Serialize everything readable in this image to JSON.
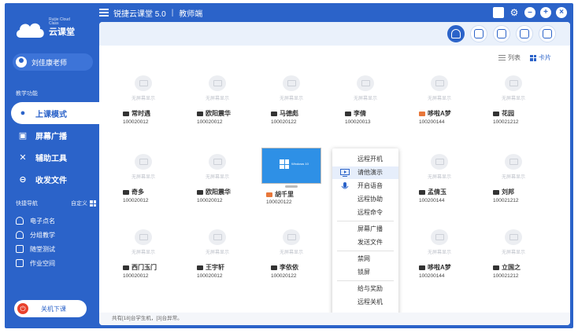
{
  "app": {
    "title": "锐捷云课堂 5.0",
    "mode": "教师端",
    "brand": "云课堂",
    "brand_small": "Ruijie Cloud Class"
  },
  "sidebar": {
    "user": "刘佳康老师",
    "section_title": "教学功能",
    "main_menu": [
      {
        "label": "上课模式",
        "icon": "bulb-icon",
        "active": true
      },
      {
        "label": "屏幕广播",
        "icon": "screen-broadcast-icon",
        "active": false
      },
      {
        "label": "辅助工具",
        "icon": "tools-icon",
        "active": false
      },
      {
        "label": "收发文件",
        "icon": "file-exchange-icon",
        "active": false
      }
    ],
    "quick_nav_title": "快捷导航",
    "quick_nav_custom": "自定义",
    "quick_nav": [
      {
        "label": "电子点名",
        "icon": "roll-call-icon"
      },
      {
        "label": "分组教学",
        "icon": "group-icon"
      },
      {
        "label": "随堂测试",
        "icon": "quiz-icon"
      },
      {
        "label": "作业空间",
        "icon": "homework-icon"
      }
    ],
    "shutdown_label": "关机下课"
  },
  "toolbar": {
    "tools": [
      "wifi-icon",
      "screenshot-icon",
      "cloud-icon",
      "hand-icon",
      "mic-icon"
    ]
  },
  "view": {
    "list_label": "列表",
    "card_label": "卡片"
  },
  "no_screen_text": "无屏幕显示",
  "students": [
    {
      "name": "常时遇",
      "id": "100020012",
      "orange": false
    },
    {
      "name": "欧阳震华",
      "id": "100020012",
      "orange": false
    },
    {
      "name": "马德彪",
      "id": "100020122",
      "orange": false
    },
    {
      "name": "李倩",
      "id": "100020013",
      "orange": false
    },
    {
      "name": "哆啦A梦",
      "id": "100200144",
      "orange": true
    },
    {
      "name": "花园",
      "id": "100021212",
      "orange": false
    },
    {
      "name": "奇多",
      "id": "100020012",
      "orange": false
    },
    {
      "name": "欧阳震华",
      "id": "100020012",
      "orange": false
    },
    {
      "name": "胡千里",
      "id": "100020122",
      "orange": true,
      "windows": true
    },
    {
      "name": "孟倩玉",
      "id": "100200144",
      "orange": false
    },
    {
      "name": "刘邦",
      "id": "100021212",
      "orange": false
    },
    {
      "name": "西门玉门",
      "id": "100020012",
      "orange": false
    },
    {
      "name": "王宇轩",
      "id": "100020012",
      "orange": false
    },
    {
      "name": "李依依",
      "id": "100020122",
      "orange": false
    },
    {
      "name": "哆啦A梦",
      "id": "100200144",
      "orange": false
    },
    {
      "name": "立国之",
      "id": "100021212",
      "orange": false
    }
  ],
  "windows_screen_text": "Windows 10",
  "context_menu": [
    {
      "label": "远程开机",
      "highlight": false,
      "icon": ""
    },
    {
      "label": "请他演示",
      "highlight": true,
      "icon": "present-icon"
    },
    {
      "label": "开启语音",
      "highlight": false,
      "icon": "mic-icon"
    },
    {
      "label": "远程协助",
      "highlight": false,
      "icon": ""
    },
    {
      "label": "远程命令",
      "highlight": false,
      "icon": ""
    },
    {
      "label": "屏幕广播",
      "highlight": false,
      "icon": ""
    },
    {
      "label": "发送文件",
      "highlight": false,
      "icon": ""
    },
    {
      "label": "禁网",
      "highlight": false,
      "icon": ""
    },
    {
      "label": "锁屏",
      "highlight": false,
      "icon": ""
    },
    {
      "label": "给与奖励",
      "highlight": false,
      "icon": ""
    },
    {
      "label": "远程关机",
      "highlight": false,
      "icon": ""
    }
  ],
  "footer": "共有[18]台学生机，[3]台异常。",
  "colors": {
    "primary": "#2b63c9",
    "orange": "#e8773a",
    "danger": "#e8412c"
  }
}
